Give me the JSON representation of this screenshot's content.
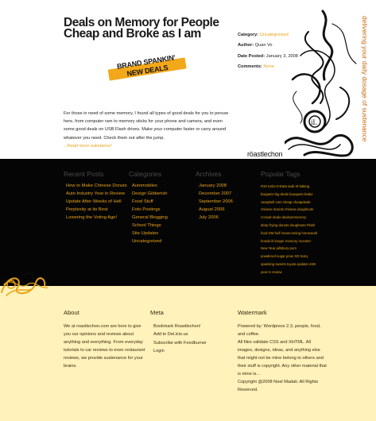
{
  "post": {
    "title": "Deals on Memory for People Cheap and Broke as I am",
    "badge_line1": "BRAND SPANKIN'",
    "badge_line2": "NEW DEALS",
    "body": "For those in need of some memory, I found all types of good deals for you to peruse here, from computer ram to memory sticks for your phone and camera, and even some good deals on USB Flash drives. Make your computer faster or carry around whatever you need. Check them out after the jump.",
    "read_more": "...Read more substance!"
  },
  "meta": {
    "category_label": "Category:",
    "category_value": "Uncategorized",
    "author_label": "Author:",
    "author_value": "Quan Vo",
    "date_label": "Date Posted:",
    "date_value": "January 3, 2008",
    "comments_label": "Comments:",
    "comments_value": "None"
  },
  "site": {
    "tagline": "delivering your daily dosage of sustenance",
    "logo": "röastlechon"
  },
  "widgets": {
    "recent_posts": {
      "heading": "Recent Posts",
      "items": [
        "How to Make Chinese Donuts",
        "Auto Industry Year in Review",
        "Update After Weeks of Hell",
        "Perplexity at its Best",
        "Lowering the Voting Age!"
      ]
    },
    "categories": {
      "heading": "Categories",
      "items": [
        "Automobiles",
        "Design Gibberish",
        "Food Stuff",
        "Foto Postings",
        "General Blogging",
        "School Things",
        "Site Updates",
        "Uncategorized"
      ]
    },
    "archives": {
      "heading": "Archives",
      "items": [
        "January 2008",
        "December 2007",
        "September 2006",
        "August 2006",
        "July 2006"
      ]
    },
    "popular_tags": {
      "heading": "Popular Tags",
      "items": [
        "R32 turbo 8-Data audi r8 baking",
        "bargains big deals bouquets brake",
        "campbell cars cheap cheapdeals",
        "chinese donuts chinese doughnuts",
        "Corsair deals dealsonmemory",
        "deep frying donuts doughnuts Flash",
        "food GM hell homecoming homework",
        "honda ik kroger memory monster",
        "New Year pillsbury porn",
        "powdered sugar prius SD Sony",
        "spanking sweets toyota update USB",
        "year in review"
      ]
    }
  },
  "footer": {
    "about": {
      "heading": "About",
      "text": "We at roastlechon.com are here to give you our opinions and reviews about anything and everything. From everyday tutorials to car reviews to even restaurant reviews, we provide sustenance for your brains."
    },
    "meta": {
      "heading": "Meta",
      "items": [
        "Bookmark Roastlechon!",
        "Add to Del.icio.us",
        "Subscribe with Feedburner",
        "Login"
      ]
    },
    "watermark": {
      "heading": "Watermark",
      "text1": "Powered by: Wordpress 2.3, people, food, and coffee.",
      "text2": "All files validate CSS and XHTML. All images, designs, ideas, and anything else that might not be mine belong to others and their stuff is copyright. Any other material that is mine is...",
      "text3": "Copyright @2008 Noel Madali. All Rights Reserved."
    }
  },
  "colors": {
    "accent": "#e8a317",
    "dark_bg": "#050505",
    "footer_bg": "#fff2ba",
    "tagline": "#c96a0c"
  }
}
